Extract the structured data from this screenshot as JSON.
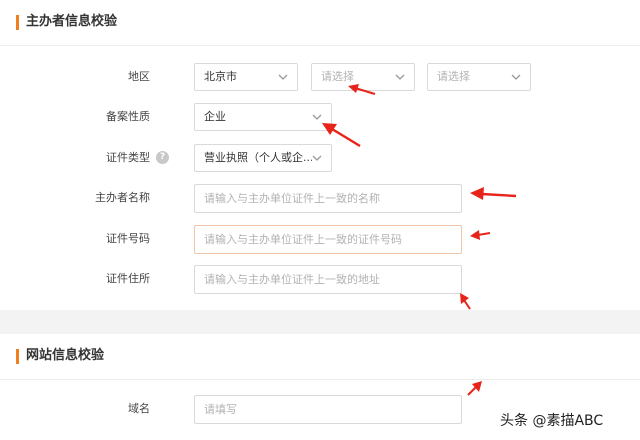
{
  "sections": {
    "sponsor_title": "主办者信息校验",
    "website_title": "网站信息校验"
  },
  "sponsor": {
    "region_label": "地区",
    "region_province": "北京市",
    "region_city_placeholder": "请选择",
    "region_district_placeholder": "请选择",
    "nature_label": "备案性质",
    "nature_value": "企业",
    "cert_type_label": "证件类型",
    "cert_type_help": "?",
    "cert_type_value": "营业执照（个人或企...",
    "name_label": "主办者名称",
    "name_placeholder": "请输入与主办单位证件上一致的名称",
    "cert_no_label": "证件号码",
    "cert_no_placeholder": "请输入与主办单位证件上一致的证件号码",
    "address_label": "证件住所",
    "address_placeholder": "请输入与主办单位证件上一致的地址"
  },
  "website": {
    "domain_label": "域名",
    "domain_placeholder": "请填写"
  },
  "watermark": "头条 @素描ABC",
  "colors": {
    "accent": "#f07f1f",
    "annotation_arrow": "#e8231a"
  },
  "icons": [
    "chevron-down-icon",
    "help-circle-icon",
    "annotation-arrow"
  ]
}
